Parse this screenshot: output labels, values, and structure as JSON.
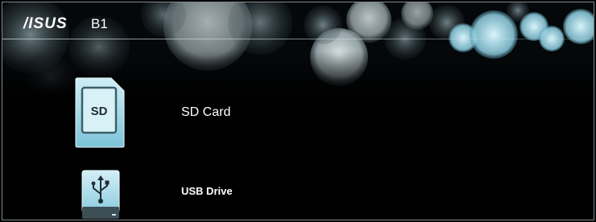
{
  "header": {
    "brand": "/ISUS",
    "model": "B1"
  },
  "devices": [
    {
      "label": "SD Card",
      "icon": "sd-card-icon",
      "icon_text": "SD"
    },
    {
      "label": "USB Drive",
      "icon": "usb-drive-icon"
    }
  ],
  "colors": {
    "background": "#000000",
    "accent": "#9fd8e6",
    "text": "#ffffff"
  }
}
